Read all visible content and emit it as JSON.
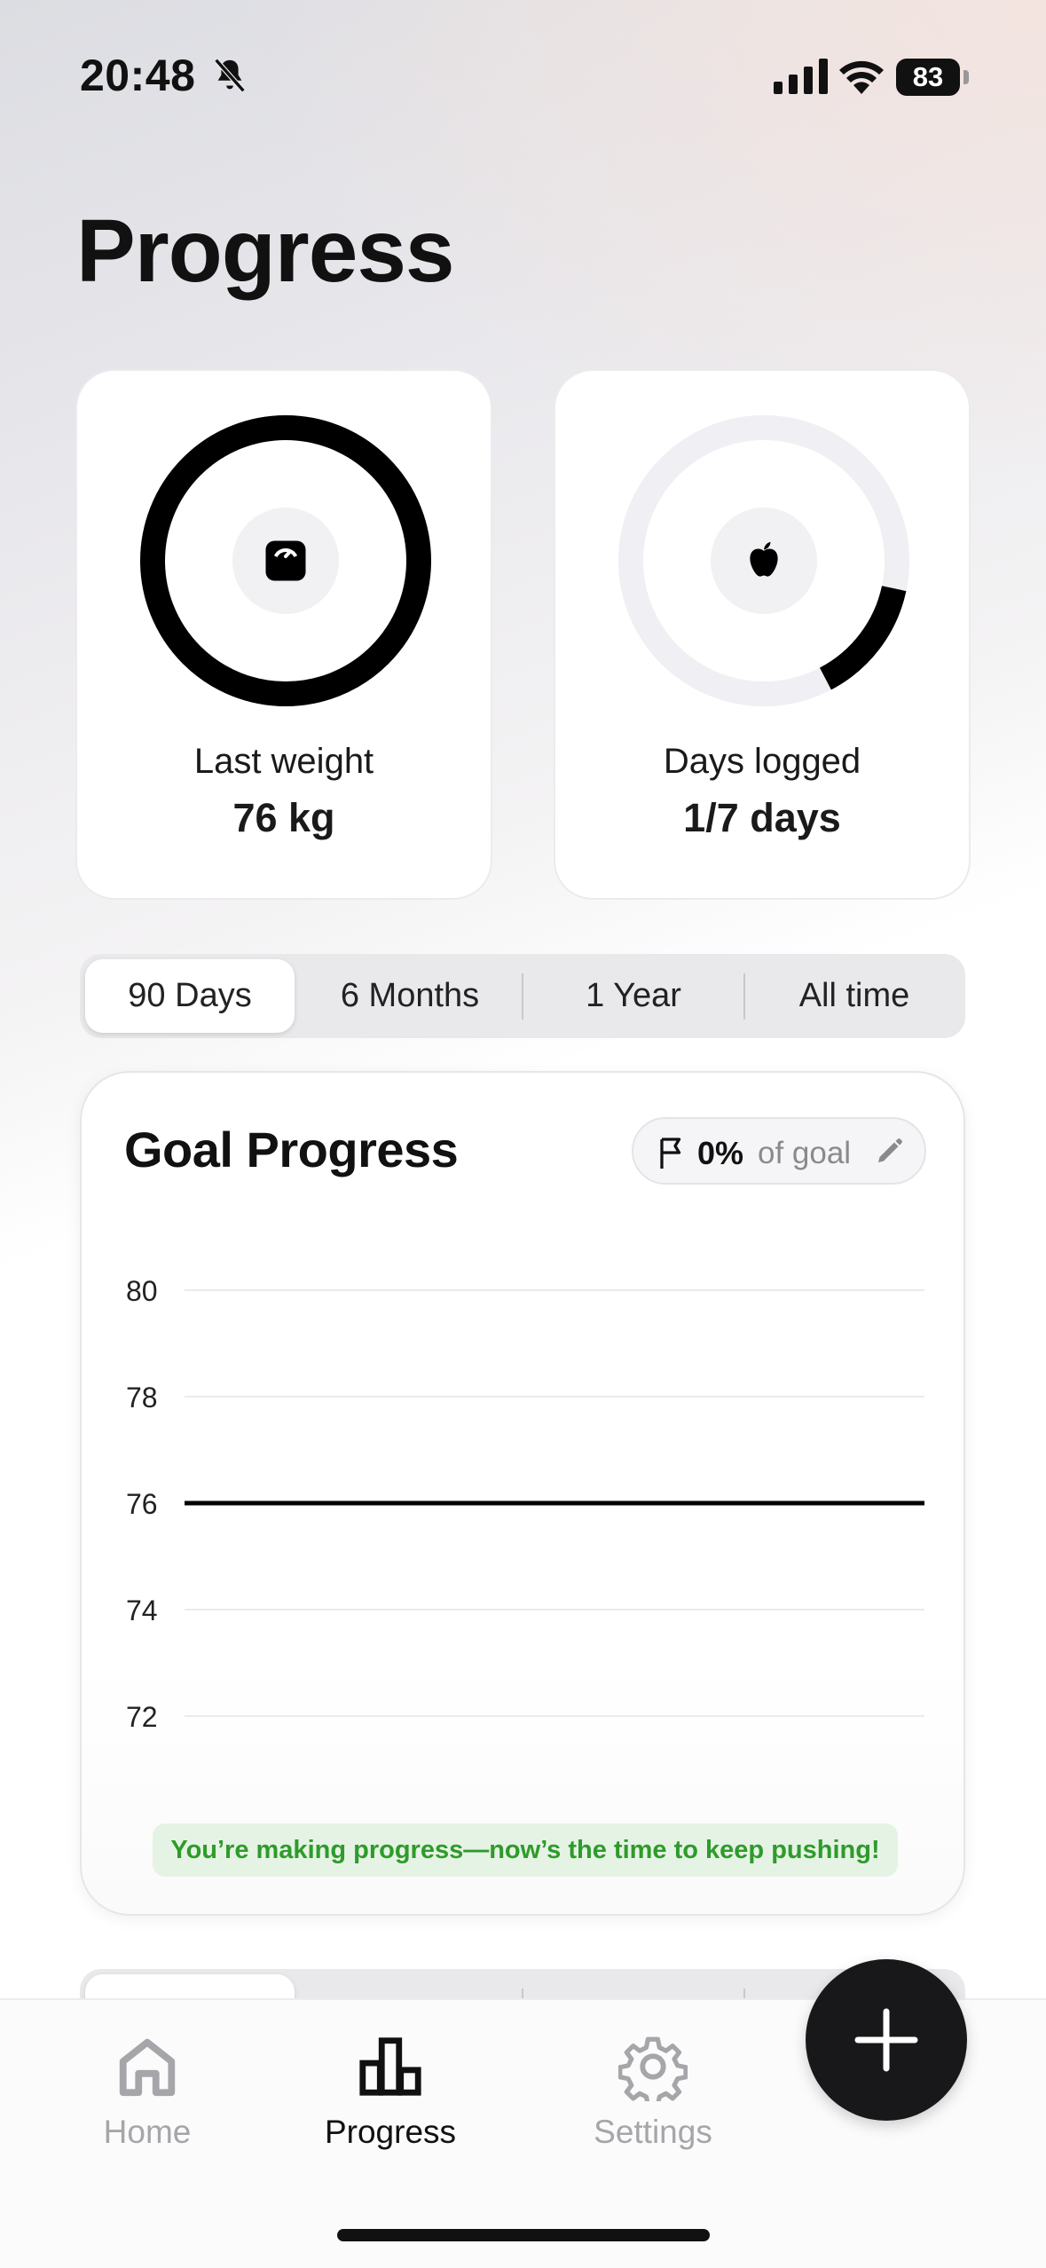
{
  "status_bar": {
    "time": "20:48",
    "battery": "83"
  },
  "page": {
    "title": "Progress"
  },
  "stats": [
    {
      "label": "Last weight",
      "value": "76 kg",
      "icon": "scale-icon",
      "progress": 1.0
    },
    {
      "label": "Days logged",
      "value": "1/7 days",
      "icon": "apple-icon",
      "progress": 0.14
    }
  ],
  "range_tabs": [
    "90 Days",
    "6 Months",
    "1 Year",
    "All time"
  ],
  "range_selected": "90 Days",
  "goal": {
    "title": "Goal Progress",
    "percent": "0%",
    "of_goal": "of goal",
    "banner": "You’re making progress—now’s the time to keep pushing!"
  },
  "chart_data": {
    "type": "line",
    "y_ticks": [
      "80",
      "78",
      "76",
      "74",
      "72"
    ],
    "ylim": [
      72,
      80
    ],
    "series": [
      {
        "values": [
          76,
          76
        ]
      }
    ],
    "grid": true
  },
  "tab_bar": {
    "items": [
      {
        "label": "Home",
        "icon": "home-icon"
      },
      {
        "label": "Progress",
        "icon": "bar-chart-icon"
      },
      {
        "label": "Settings",
        "icon": "gear-icon"
      }
    ],
    "active": "Progress"
  },
  "fab": {
    "icon": "plus-icon"
  },
  "colors": {
    "accent": "#111111",
    "track": "#efeff4",
    "success_text": "#2e9b2a",
    "success_bg": "#e5f3e4"
  }
}
